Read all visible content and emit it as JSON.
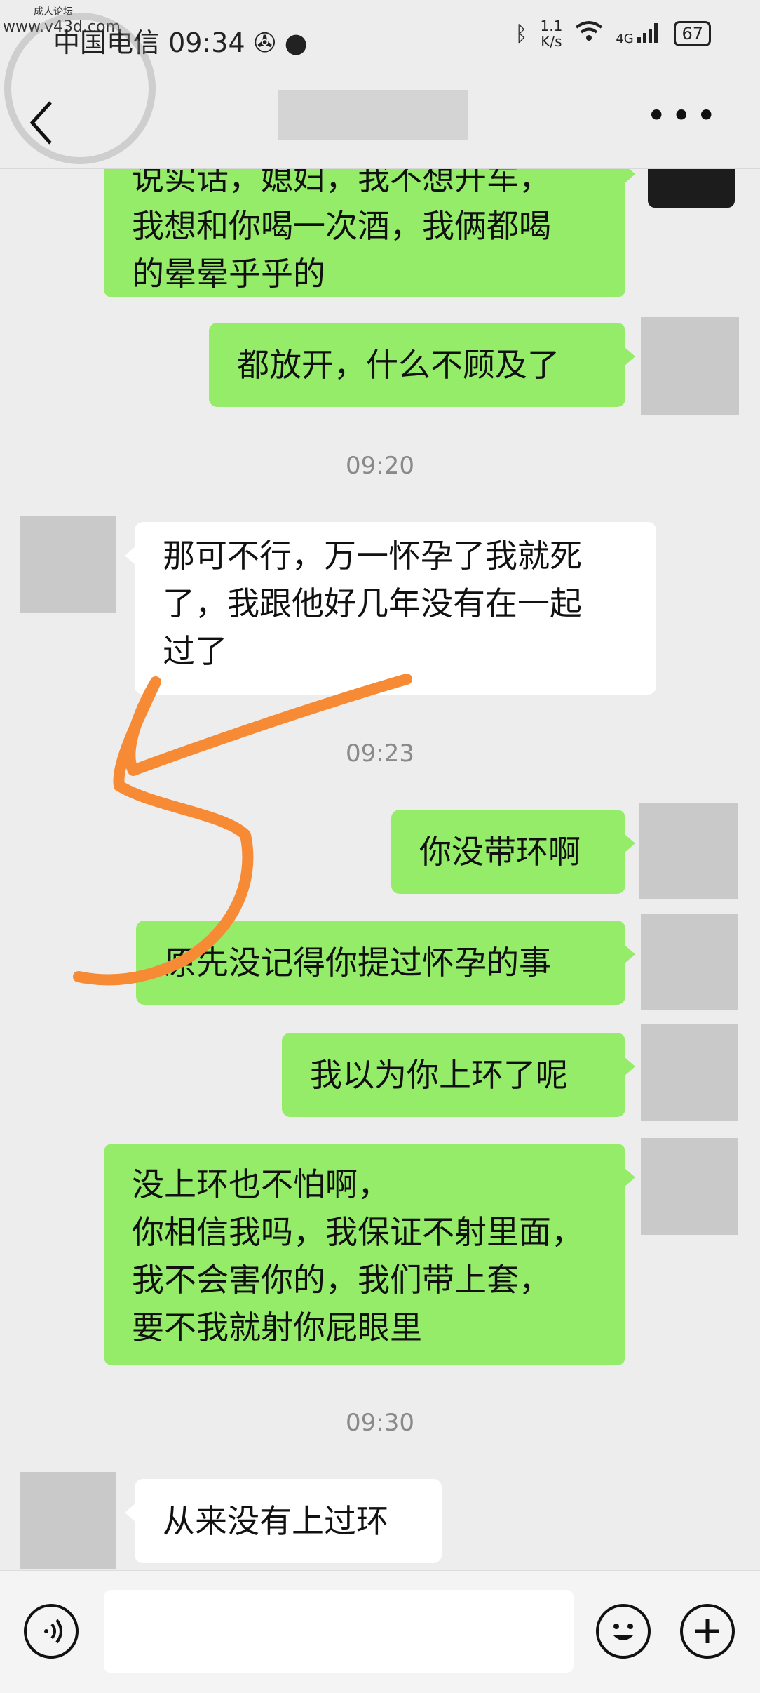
{
  "status_bar": {
    "carrier": "中国电信",
    "time": "09:34",
    "speed_value": "1.1",
    "speed_unit": "K/s",
    "network": "4G",
    "battery": "67"
  },
  "watermark": {
    "site_label": "成人论坛",
    "site_url": "www.v43d.com"
  },
  "header": {
    "title": "",
    "more_label": "•••"
  },
  "messages": {
    "m1": "说实话，媳妇，我不想开车，\n我想和你喝一次酒，我俩都喝\n的晕晕乎乎的",
    "m2": "都放开，什么不顾及了",
    "t1": "09:20",
    "m3": "那可不行，万一怀孕了我就死\n了，我跟他好几年没有在一起\n过了",
    "t2": "09:23",
    "m4": "你没带环啊",
    "m5": "原先没记得你提过怀孕的事",
    "m6": "我以为你上环了呢",
    "m7": "没上环也不怕啊，\n你相信我吗，我保证不射里面，\n我不会害你的，我们带上套，\n要不我就射你屁眼里",
    "t3": "09:30",
    "m8": "从来没有上过环"
  },
  "annotation": {
    "color": "#f78a35"
  },
  "input_bar": {
    "placeholder": ""
  },
  "colors": {
    "bubble_green": "#95ec69",
    "bubble_white": "#ffffff",
    "background": "#ededed"
  }
}
